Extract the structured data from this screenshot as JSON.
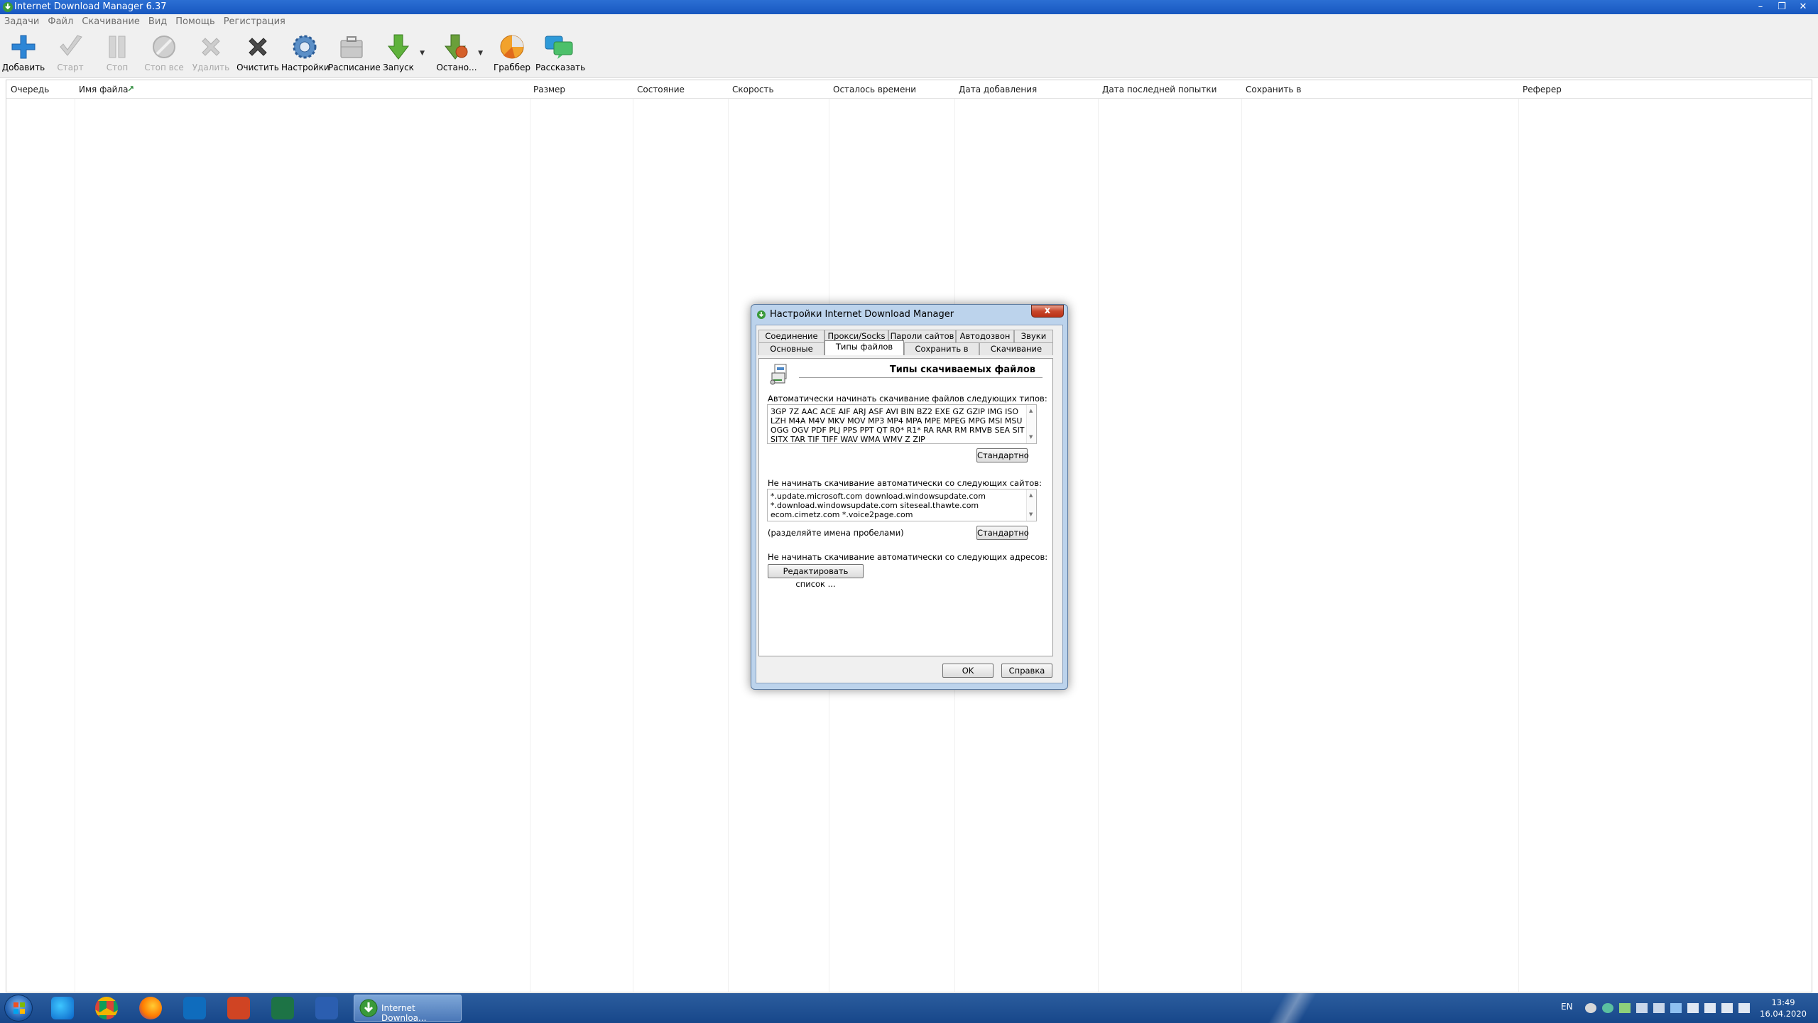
{
  "window": {
    "title": "Internet Download Manager 6.37",
    "controls": [
      "–",
      "❐",
      "✕"
    ]
  },
  "menu": [
    "Задачи",
    "Файл",
    "Скачивание",
    "Вид",
    "Помощь",
    "Регистрация"
  ],
  "toolbar": [
    {
      "label": "Добавить",
      "icon": "add-icon",
      "enabled": true
    },
    {
      "label": "Старт",
      "icon": "start-icon",
      "enabled": false
    },
    {
      "label": "Стоп",
      "icon": "stop-icon",
      "enabled": false
    },
    {
      "label": "Стоп все",
      "icon": "stop-all-icon",
      "enabled": false
    },
    {
      "label": "Удалить",
      "icon": "delete-icon",
      "enabled": false
    },
    {
      "label": "Очистить",
      "icon": "clear-icon",
      "enabled": true
    },
    {
      "label": "Настройки",
      "icon": "settings-icon",
      "enabled": true
    },
    {
      "label": "Расписание",
      "icon": "scheduler-icon",
      "enabled": true
    },
    {
      "label": "Запуск",
      "icon": "start-queue-icon",
      "enabled": true
    },
    {
      "label": "Остано...",
      "icon": "stop-queue-icon",
      "enabled": true
    },
    {
      "label": "Граббер",
      "icon": "grabber-icon",
      "enabled": true
    },
    {
      "label": "Рассказать",
      "icon": "tell-friend-icon",
      "enabled": true
    }
  ],
  "columns": [
    "Очередь",
    "Имя файла",
    "Размер",
    "Состояние",
    "Скорость",
    "Осталось времени",
    "Дата добавления",
    "Дата последней попытки",
    "Сохранить в",
    "Реферер"
  ],
  "dialog": {
    "title": "Настройки Internet Download Manager",
    "close": "x",
    "tabs_row1": [
      "Соединение",
      "Прокси/Socks",
      "Пароли сайтов",
      "Автодозвон",
      "Звуки"
    ],
    "tabs_row2": [
      "Основные",
      "Типы файлов",
      "Сохранить в",
      "Скачивание"
    ],
    "section_title": "Типы скачиваемых файлов",
    "label_types": "Автоматически начинать скачивание файлов следующих типов:",
    "file_types": "3GP 7Z AAC ACE AIF ARJ ASF AVI BIN BZ2 EXE GZ GZIP IMG ISO LZH M4A M4V MKV MOV MP3 MP4 MPA MPE MPEG MPG MSI MSU OGG OGV PDF PLJ PPS PPT QT R0* R1* RA RAR RM RMVB SEA SIT SITX TAR TIF TIFF WAV WMA WMV Z ZIP",
    "default_button": "Стандартно",
    "label_sites": "Не начинать скачивание автоматически со следующих сайтов:",
    "sites": "*.update.microsoft.com download.windowsupdate.com *.download.windowsupdate.com siteseal.thawte.com ecom.cimetz.com *.voice2page.com",
    "sites_hint": "(разделяйте имена пробелами)",
    "label_addresses": "Не начинать скачивание автоматически со следующих адресов:",
    "edit_list_button": "Редактировать список ...",
    "ok_button": "OK",
    "help_button": "Справка"
  },
  "taskbar": {
    "active_task": "Internet Downloa...",
    "language": "EN",
    "time": "13:49",
    "date": "16.04.2020"
  },
  "colors": {
    "titlebar": "#1f63cc",
    "taskbar": "#1f4f92",
    "dialog_frame": "#bcd3ec"
  }
}
